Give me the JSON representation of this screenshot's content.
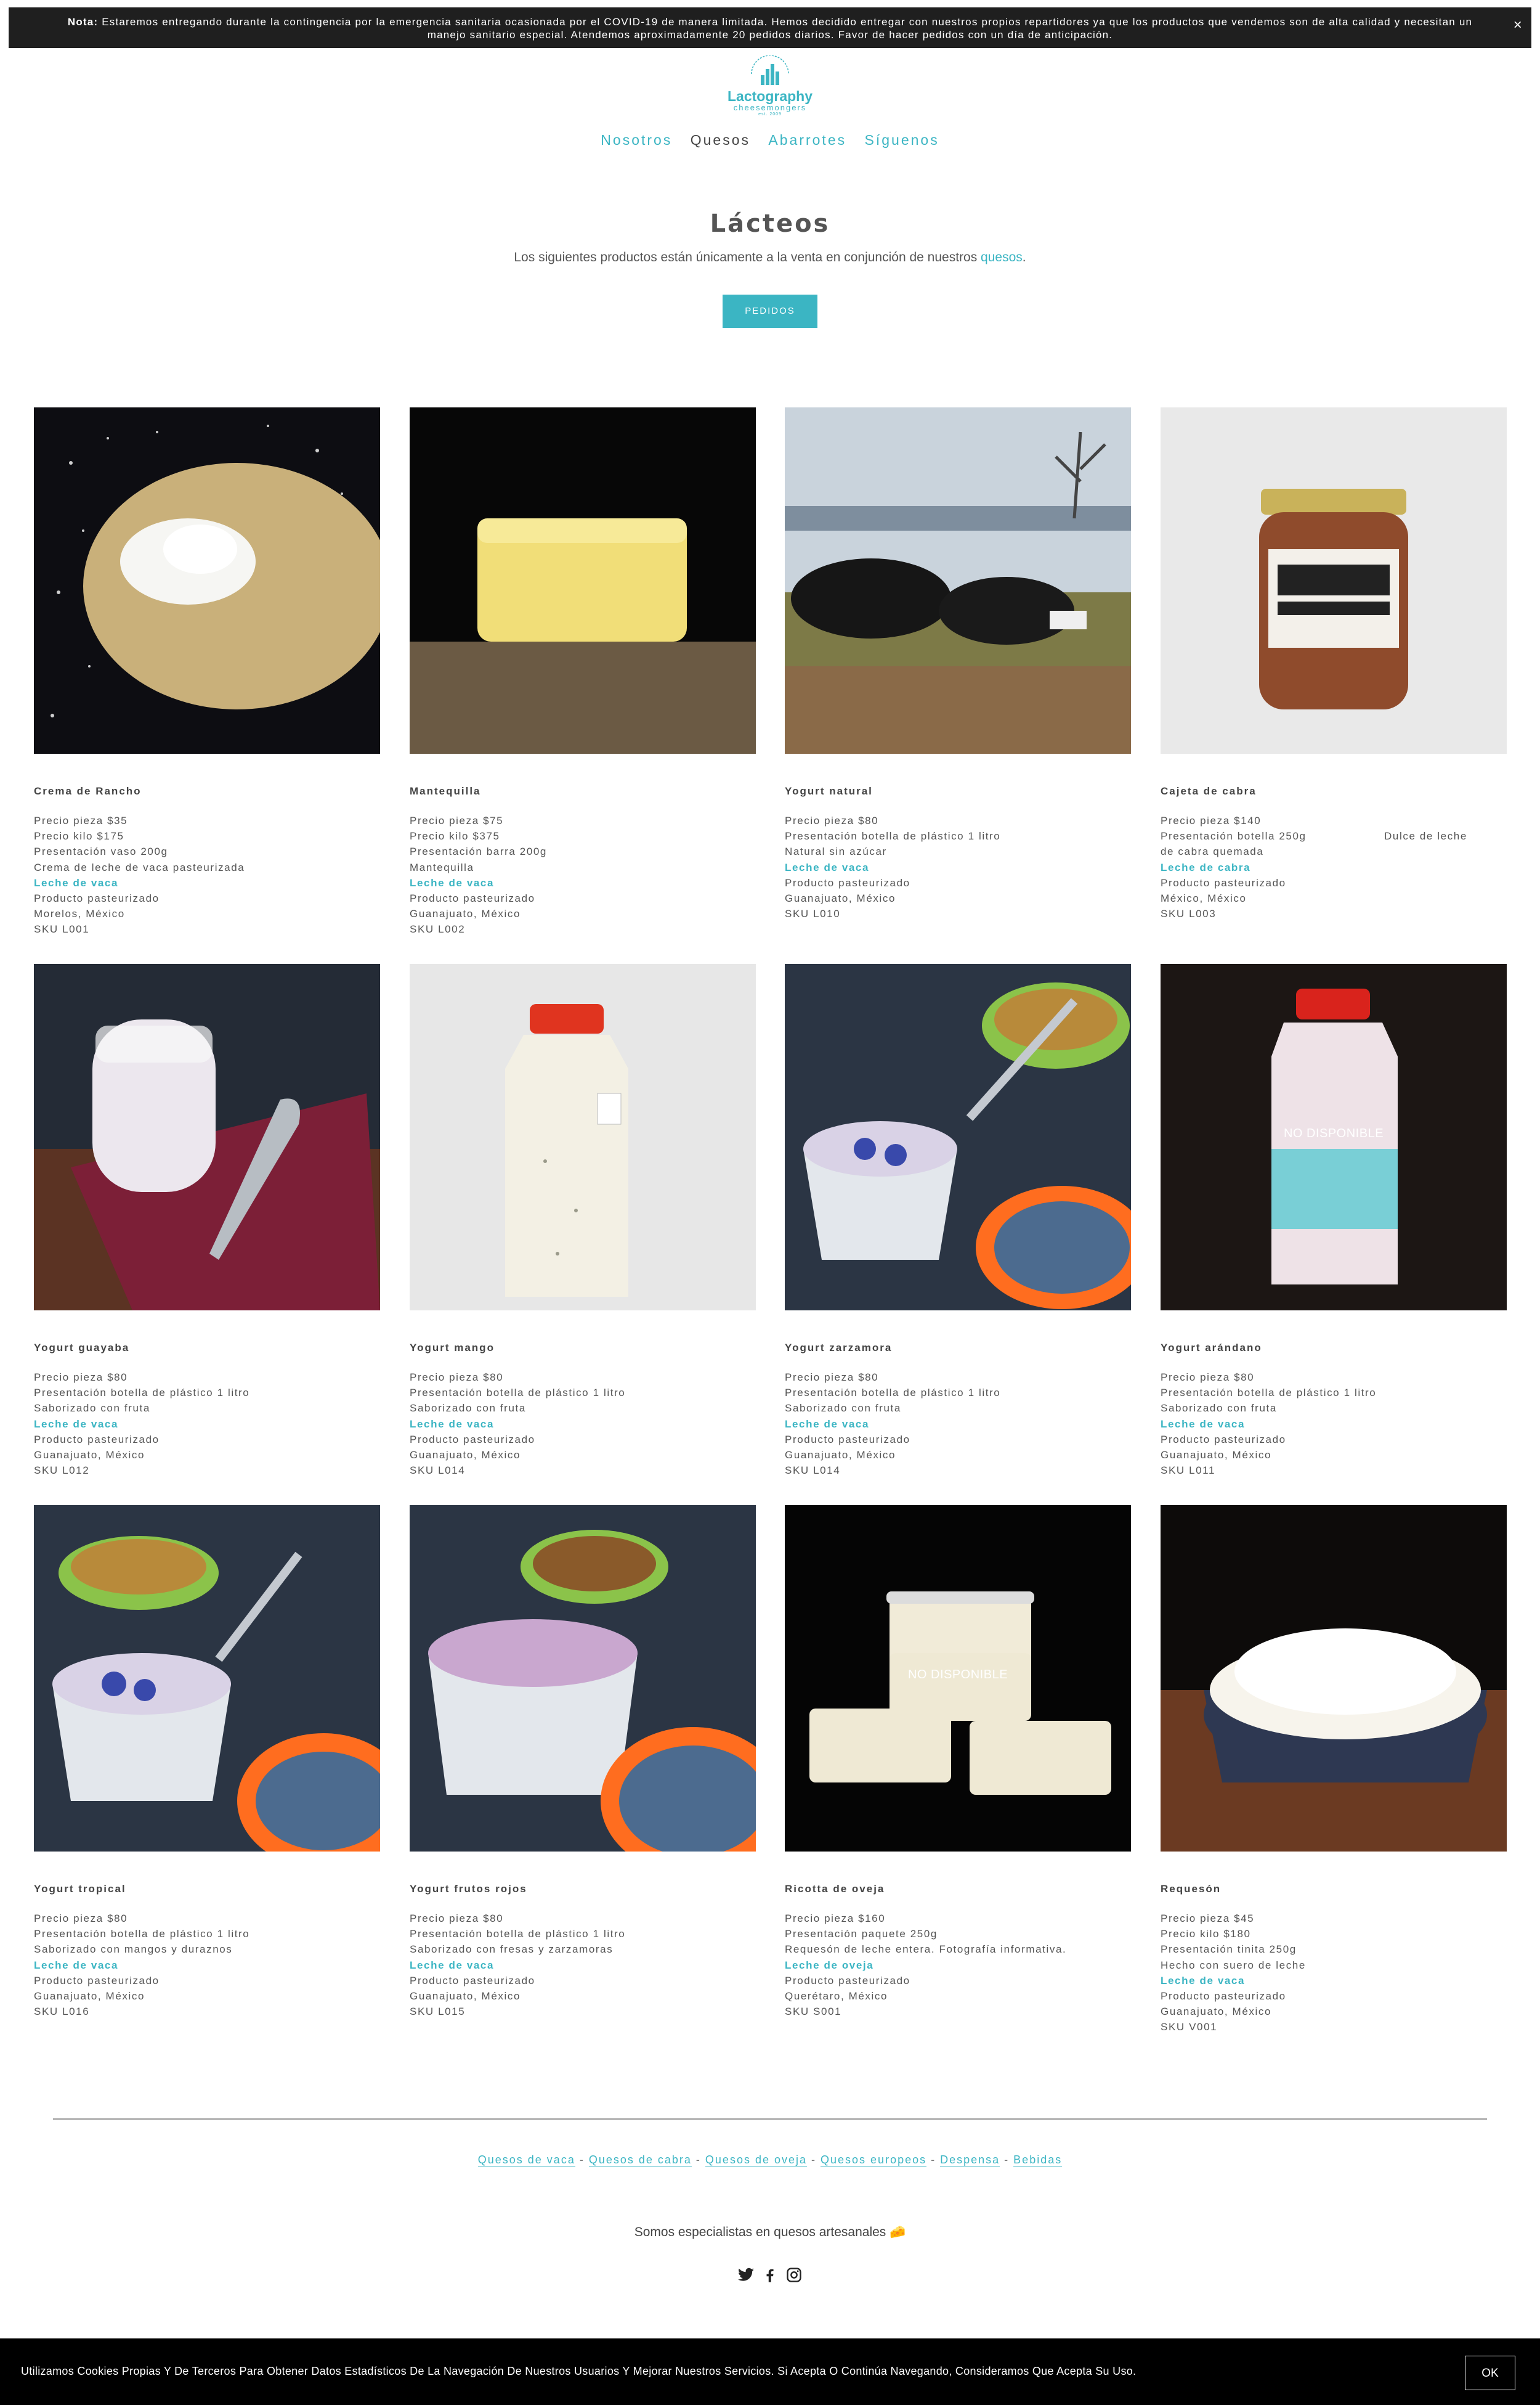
{
  "notice": {
    "label": "Nota:",
    "text": " Estaremos entregando durante la contingencia por la emergencia sanitaria ocasionada por el COVID-19 de manera limitada. Hemos decidido entregar con nuestros propios repartidores ya que los productos que vendemos son de alta calidad y necesitan un manejo sanitario especial. Atendemos aproximadamente 20 pedidos diarios. Favor de hacer pedidos con un día de anticipación.",
    "close": "×"
  },
  "logo": {
    "name": "Lactography",
    "sub": "cheesemongers",
    "tiny": "est. 2009"
  },
  "nav": [
    {
      "label": "Nosotros",
      "current": false
    },
    {
      "label": "Quesos",
      "current": true
    },
    {
      "label": "Abarrotes",
      "current": false
    },
    {
      "label": "Síguenos",
      "current": false
    }
  ],
  "header": {
    "title": "Lácteos",
    "intro": "Los siguientes productos están únicamente a la venta en conjunción de nuestros",
    "intro_link": "quesos",
    "intro_end": ".",
    "button": "PEDIDOS"
  },
  "colors": {
    "accent": "#3bb5c3",
    "dark": "#1f1f1f"
  },
  "products": [
    {
      "name": "Crema de Rancho",
      "lines": [
        "Precio pieza $35",
        "Precio kilo $175",
        "Presentación vaso 200g",
        "Crema de leche de vaca pasteurizada"
      ],
      "link": "Leche de vaca",
      "after": [
        "Producto pasteurizado",
        "Morelos, México",
        "SKU L001"
      ],
      "badge": ""
    },
    {
      "name": "Mantequilla",
      "lines": [
        "Precio pieza $75",
        "Precio kilo $375",
        "Presentación barra 200g",
        "Mantequilla"
      ],
      "link": "Leche de vaca",
      "after": [
        "Producto pasteurizado",
        "Guanajuato, México",
        "SKU L002"
      ],
      "badge": ""
    },
    {
      "name": "Yogurt natural",
      "lines": [
        "Precio pieza $80",
        "Presentación botella de plástico 1 litro",
        "Natural sin azúcar"
      ],
      "link": "Leche de vaca",
      "after": [
        "Producto pasteurizado",
        "Guanajuato, México",
        "SKU L010"
      ],
      "badge": ""
    },
    {
      "name": "Cajeta de cabra",
      "lines": [
        "Precio pieza $140",
        "Presentación botella 250g                    Dulce de leche",
        "de cabra quemada"
      ],
      "link": "Leche de cabra",
      "after": [
        "Producto pasteurizado",
        "México, México",
        "SKU L003"
      ],
      "badge": ""
    },
    {
      "name": "Yogurt guayaba",
      "lines": [
        "Precio pieza $80",
        "Presentación botella de plástico 1 litro",
        "Saborizado con fruta"
      ],
      "link": "Leche de vaca",
      "after": [
        "Producto pasteurizado",
        "Guanajuato, México",
        "SKU L012"
      ],
      "badge": ""
    },
    {
      "name": "Yogurt mango",
      "lines": [
        "Precio pieza $80",
        "Presentación botella de plástico 1 litro",
        "Saborizado con fruta"
      ],
      "link": "Leche de vaca",
      "after": [
        "Producto pasteurizado",
        "Guanajuato, México",
        "SKU L014"
      ],
      "badge": ""
    },
    {
      "name": "Yogurt zarzamora",
      "lines": [
        "Precio pieza $80",
        "Presentación botella de plástico 1 litro",
        "Saborizado con fruta"
      ],
      "link": "Leche de vaca",
      "after": [
        "Producto pasteurizado",
        "Guanajuato, México",
        "SKU L014"
      ],
      "badge": ""
    },
    {
      "name": "Yogurt arándano",
      "lines": [
        "Precio pieza $80",
        "Presentación botella de plástico 1 litro",
        "Saborizado con fruta"
      ],
      "link": "Leche de vaca",
      "after": [
        "Producto pasteurizado",
        "Guanajuato, México",
        "SKU L011"
      ],
      "badge": "NO DISPONIBLE"
    },
    {
      "name": "Yogurt tropical",
      "lines": [
        "Precio pieza $80",
        "Presentación botella de plástico 1 litro",
        "Saborizado con mangos y duraznos"
      ],
      "link": "Leche de vaca",
      "after": [
        "Producto pasteurizado",
        "Guanajuato, México",
        "SKU L016"
      ],
      "badge": ""
    },
    {
      "name": "Yogurt frutos rojos",
      "lines": [
        "Precio pieza $80",
        "Presentación botella de plástico 1 litro",
        "Saborizado con fresas y zarzamoras"
      ],
      "link": "Leche de vaca",
      "after": [
        "Producto pasteurizado",
        "Guanajuato, México",
        "SKU L015"
      ],
      "badge": ""
    },
    {
      "name": "Ricotta de oveja",
      "lines": [
        "Precio pieza $160",
        "Presentación paquete 250g",
        "Requesón de leche entera. Fotografía informativa."
      ],
      "link": "Leche de oveja",
      "after": [
        "Producto pasteurizado",
        "Querétaro, México",
        "SKU S001"
      ],
      "badge": "NO DISPONIBLE"
    },
    {
      "name": "Requesón",
      "lines": [
        "Precio pieza $45",
        "Precio kilo $180",
        "Presentación tinita 250g",
        "Hecho con suero de leche"
      ],
      "link": "Leche de vaca",
      "after": [
        "Producto pasteurizado",
        "Guanajuato, México",
        "SKU V001"
      ],
      "badge": ""
    }
  ],
  "footer": {
    "links": [
      "Quesos de vaca",
      "Quesos de cabra",
      "Quesos de oveja",
      "Quesos europeos",
      "Despensa",
      "Bebidas"
    ],
    "separator": " - ",
    "tagline": "Somos especialistas en quesos artesanales 🧀",
    "social": [
      "twitter-icon",
      "facebook-icon",
      "instagram-icon"
    ]
  },
  "cookie": {
    "text": "Utilizamos Cookies Propias Y De Terceros Para Obtener Datos Estadísticos De La Navegación De Nuestros Usuarios Y Mejorar Nuestros Servicios. Si Acepta O Continúa Navegando, Consideramos Que Acepta Su Uso.",
    "ok": "OK"
  }
}
